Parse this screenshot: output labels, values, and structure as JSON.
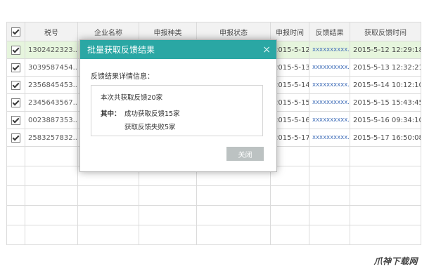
{
  "table": {
    "headers": [
      "税号",
      "企业名称",
      "申报种类",
      "申报状态",
      "申报时间",
      "反馈结果",
      "获取反馈时间"
    ],
    "rows": [
      {
        "tax_no": "1302422323...",
        "date": "2015-5-12",
        "link": "xxxxxxxxxx...",
        "fetch_time": "2015-5-12 12:29:18",
        "checked": true,
        "selected": true
      },
      {
        "tax_no": "3039587454...",
        "date": "2015-5-13",
        "link": "xxxxxxxxxx...",
        "fetch_time": "2015-5-13 12:32:21",
        "checked": true,
        "selected": false
      },
      {
        "tax_no": "2356845453...",
        "date": "2015-5-14",
        "link": "xxxxxxxxxx...",
        "fetch_time": "2015-5-14 10:12:10",
        "checked": true,
        "selected": false
      },
      {
        "tax_no": "2345643567...",
        "date": "2015-5-15",
        "link": "xxxxxxxxxx...",
        "fetch_time": "2015-5-15 15:43:45",
        "checked": true,
        "selected": false
      },
      {
        "tax_no": "0023887353...",
        "date": "2015-5-16",
        "link": "xxxxxxxxxx...",
        "fetch_time": "2015-5-16 09:34:10",
        "checked": true,
        "selected": false
      },
      {
        "tax_no": "2583257832...",
        "date": "2015-5-17",
        "link": "xxxxxxxxxx...",
        "fetch_time": "2015-5-17 16:50:08",
        "checked": true,
        "selected": false
      }
    ]
  },
  "dialog": {
    "title": "批量获取反馈结果",
    "close_icon": "×",
    "label": "反馈结果详情信息：",
    "total": "本次共获取反馈20家",
    "prefix": "其中：",
    "success": "成功获取反馈15家",
    "fail": "获取反馈失败5家",
    "close_button": "关闭"
  },
  "watermark": "爪神下载网",
  "colors": {
    "dialog_header": "#2aa7a4",
    "selected_row": "#e3f4d9",
    "link": "#2a5db0",
    "button_disabled": "#bcc2c2"
  }
}
